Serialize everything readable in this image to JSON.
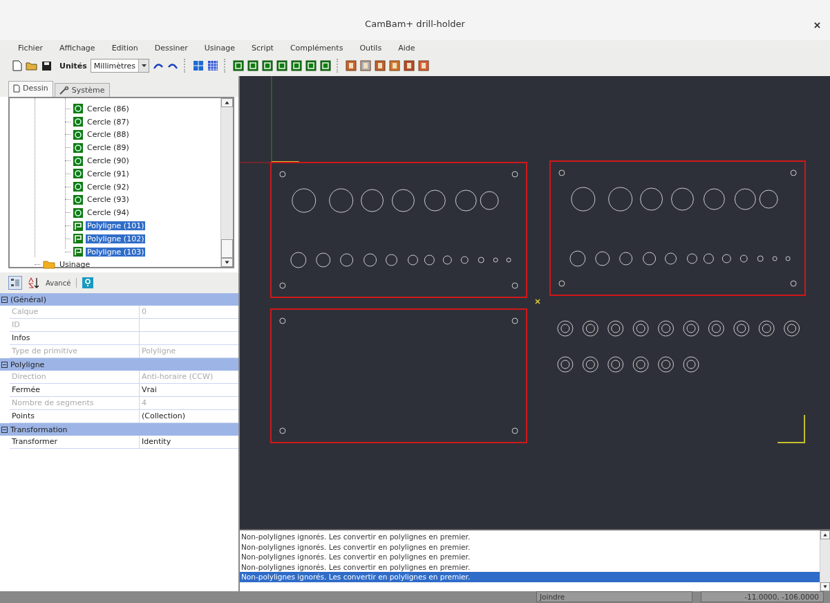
{
  "window": {
    "title": "CamBam+ drill-holder"
  },
  "menu": [
    "Fichier",
    "Affichage",
    "Edition",
    "Dessiner",
    "Usinage",
    "Script",
    "Compléments",
    "Outils",
    "Aide"
  ],
  "toolbar": {
    "units_label": "Unités",
    "units_value": "Millimètres"
  },
  "tabs": [
    {
      "label": "Dessin",
      "selected": true
    },
    {
      "label": "Système",
      "selected": false
    }
  ],
  "tree": [
    {
      "children": [
        {
          "label": "Cercle (86)",
          "kind": "circle",
          "selected": false
        },
        {
          "label": "Cercle (87)",
          "kind": "circle",
          "selected": false
        },
        {
          "label": "Cercle (88)",
          "kind": "circle",
          "selected": false
        },
        {
          "label": "Cercle (89)",
          "kind": "circle",
          "selected": false
        },
        {
          "label": "Cercle (90)",
          "kind": "circle",
          "selected": false
        },
        {
          "label": "Cercle (91)",
          "kind": "circle",
          "selected": false
        },
        {
          "label": "Cercle (92)",
          "kind": "circle",
          "selected": false
        },
        {
          "label": "Cercle (93)",
          "kind": "circle",
          "selected": false
        },
        {
          "label": "Cercle (94)",
          "kind": "circle",
          "selected": false
        },
        {
          "label": "Polyligne (101)",
          "kind": "polyline",
          "selected": true
        },
        {
          "label": "Polyligne (102)",
          "kind": "polyline",
          "selected": true
        },
        {
          "label": "Polyligne (103)",
          "kind": "polyline",
          "selected": true
        }
      ]
    },
    {
      "label": "Usinage",
      "kind": "folder",
      "selected": false
    }
  ],
  "properties": {
    "toolbar_label": "Avancé",
    "groups": [
      {
        "name": "(Général)",
        "expanded": true,
        "rows": [
          {
            "name": "Calque",
            "value": "0",
            "disabled": true
          },
          {
            "name": "ID",
            "value": "",
            "disabled": true
          },
          {
            "name": "Infos",
            "value": "",
            "disabled": false
          },
          {
            "name": "Type de primitive",
            "value": "Polyligne",
            "disabled": true
          }
        ]
      },
      {
        "name": "Polyligne",
        "expanded": true,
        "rows": [
          {
            "name": "Direction",
            "value": "Anti-horaire (CCW)",
            "disabled": true
          },
          {
            "name": "Fermée",
            "value": "Vrai",
            "disabled": false
          },
          {
            "name": "Nombre de segments",
            "value": "4",
            "disabled": true
          },
          {
            "name": "Points",
            "value": "(Collection)",
            "disabled": false
          }
        ]
      },
      {
        "name": "Transformation",
        "expanded": true,
        "rows": [
          {
            "name": "Transformer",
            "value": "Identity",
            "disabled": false
          }
        ]
      }
    ]
  },
  "log": [
    {
      "text": "Non-polylignes ignorés. Les convertir en polylignes en premier.",
      "selected": false
    },
    {
      "text": "Non-polylignes ignorés. Les convertir en polylignes en premier.",
      "selected": false
    },
    {
      "text": "Non-polylignes ignorés. Les convertir en polylignes en premier.",
      "selected": false
    },
    {
      "text": "Non-polylignes ignorés. Les convertir en polylignes en premier.",
      "selected": false
    },
    {
      "text": "Non-polylignes ignorés. Les convertir en polylignes en premier.",
      "selected": true
    }
  ],
  "status_bar": {
    "message": "Joindre",
    "coordinates": "-11.0000, -106.0000"
  }
}
